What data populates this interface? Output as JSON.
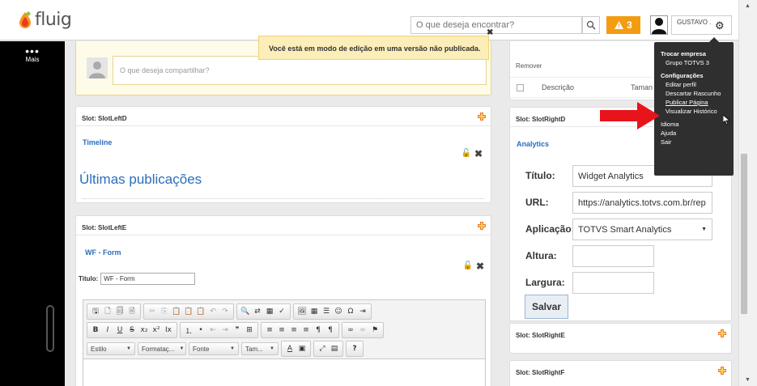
{
  "header": {
    "logo_text": "fluig",
    "search_placeholder": "O que deseja encontrar?",
    "alert_count": "3",
    "user_name": "GUSTAVO ."
  },
  "sidebar": {
    "more_label": "Mais"
  },
  "edit_banner": {
    "text": "Você está em modo de edição em uma versão não publicada."
  },
  "share": {
    "placeholder": "O que deseja compartilhar?"
  },
  "slot_left_d": {
    "title": "Slot: SlotLeftD",
    "widget": "Timeline",
    "heading": "Últimas publicações"
  },
  "slot_left_e": {
    "title": "Slot: SlotLeftE",
    "widget": "WF - Form",
    "field_label": "Titulo:",
    "field_value": "WF - Form"
  },
  "editor": {
    "style_combo": "Estilo",
    "format_combo": "Formataç...",
    "font_combo": "Fonte",
    "size_combo": "Tam..."
  },
  "right_top": {
    "remove_label": "Remover",
    "col_description": "Descrição",
    "col_size": "Taman"
  },
  "slot_right_d": {
    "title": "Slot: SlotRightD",
    "widget": "Analytics",
    "label_title": "Título:",
    "value_title": "Widget Analytics",
    "label_url": "URL:",
    "value_url": "https://analytics.totvs.com.br/rep",
    "label_app": "Aplicação:",
    "value_app": "TOTVS Smart Analytics",
    "label_height": "Altura:",
    "label_width": "Largura:",
    "save_label": "Salvar"
  },
  "slot_right_e": {
    "title": "Slot: SlotRightE"
  },
  "slot_right_f": {
    "title": "Slot: SlotRightF"
  },
  "dropdown": {
    "switch_company": "Trocar empresa",
    "company_name": "Grupo TOTVS 3",
    "settings": "Configurações",
    "edit_profile": "Editar perfil",
    "discard_draft": "Descartar Rascunho",
    "publish_page": "Publicar Página",
    "view_history": "Visualizar Histórico",
    "language": "Idioma",
    "help": "Ajuda",
    "logout": "Sair"
  },
  "colors": {
    "accent_blue": "#2a6ebb",
    "alert_orange": "#f39c12",
    "banner_yellow": "#fbeeb8",
    "arrow_red": "#e8141b",
    "menu_dark": "#2f2f2f"
  }
}
